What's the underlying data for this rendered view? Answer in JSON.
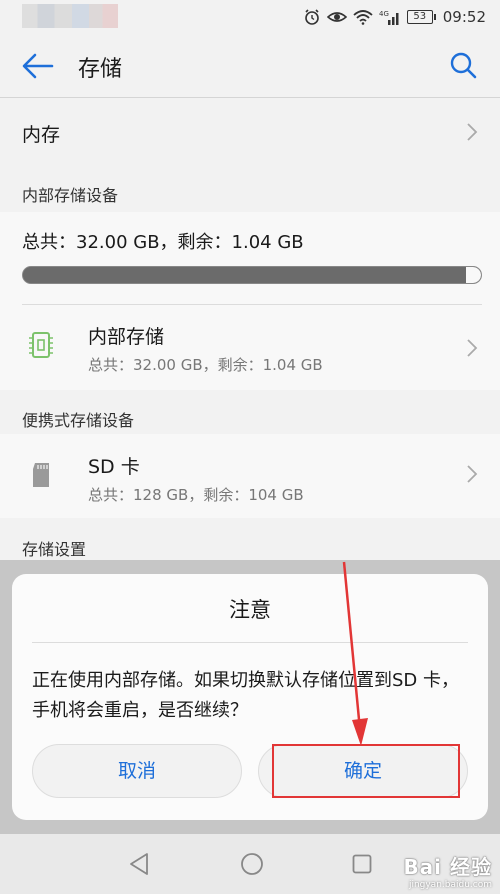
{
  "status_bar": {
    "time": "09:52",
    "battery": "53",
    "signal_label": "4G"
  },
  "app_bar": {
    "title": "存储"
  },
  "memory_row": {
    "label": "内存"
  },
  "internal_section": {
    "header": "内部存储设备",
    "summary": "总共：32.00 GB，剩余：1.04 GB",
    "usage_fraction": 0.9675,
    "item": {
      "title": "内部存储",
      "subtitle": "总共：32.00 GB，剩余：1.04 GB"
    }
  },
  "portable_section": {
    "header": "便携式存储设备",
    "item": {
      "title": "SD 卡",
      "subtitle": "总共：128 GB，剩余：104 GB"
    }
  },
  "settings_section": {
    "header": "存储设置"
  },
  "dialog": {
    "title": "注意",
    "message": "正在使用内部存储。如果切换默认存储位置到SD 卡，手机将会重启，是否继续？",
    "cancel_label": "取消",
    "confirm_label": "确定"
  },
  "watermark": {
    "brand": "Bai 经验",
    "url": "jingyan.baidu.com"
  },
  "colors": {
    "accent": "#1e6fd9",
    "highlight": "#e23636",
    "chip_icon": "#7cc26b"
  }
}
